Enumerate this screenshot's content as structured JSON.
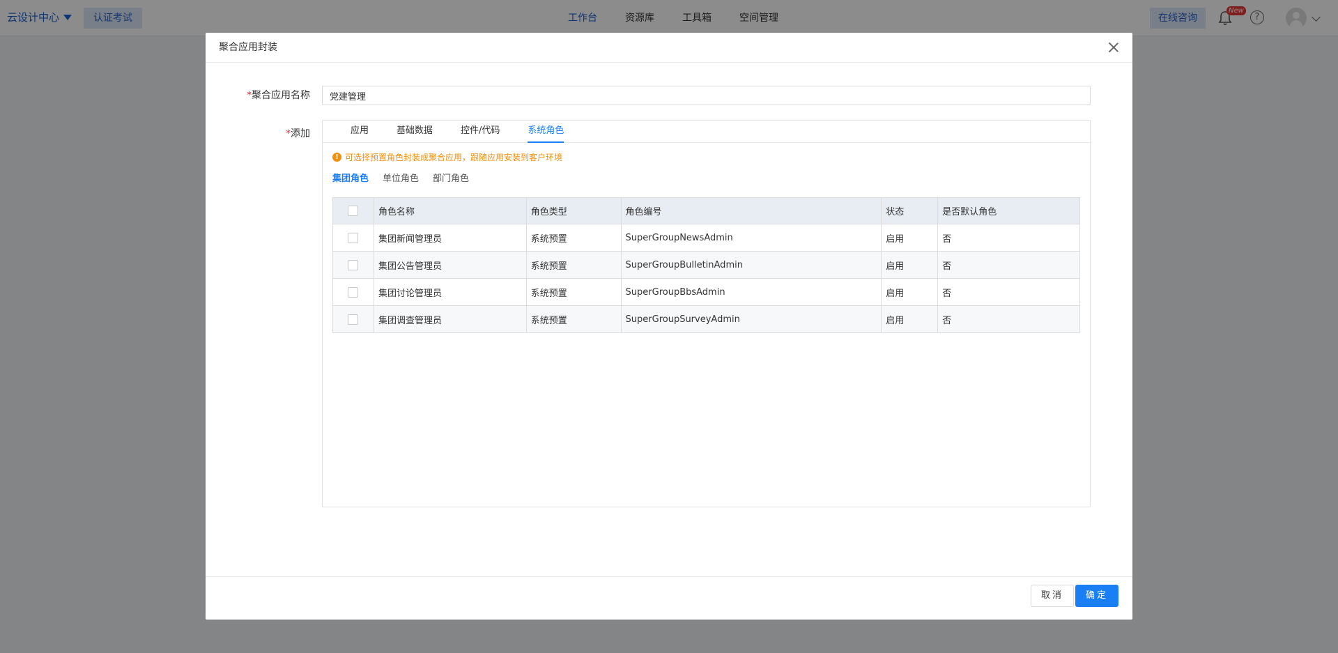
{
  "topbar": {
    "brand": "云设计中心",
    "cert_button": "认证考试",
    "nav": [
      "工作台",
      "资源库",
      "工具箱",
      "空间管理"
    ],
    "consult_button": "在线咨询",
    "new_badge": "New",
    "help_glyph": "?"
  },
  "modal": {
    "title": "聚合应用封装",
    "name_label": "聚合应用名称",
    "name_value": "党建管理",
    "add_label": "添加",
    "required_mark": "*",
    "tabs": [
      "应用",
      "基础数据",
      "控件/代码",
      "系统角色"
    ],
    "active_tab": "系统角色",
    "notice": "可选择预置角色封装成聚合应用，跟随应用安装到客户环境",
    "notice_icon_glyph": "!",
    "subtabs": [
      "集团角色",
      "单位角色",
      "部门角色"
    ],
    "active_subtab": "集团角色",
    "table": {
      "headers": [
        "角色名称",
        "角色类型",
        "角色编号",
        "状态",
        "是否默认角色"
      ],
      "rows": [
        [
          "集团新闻管理员",
          "系统预置",
          "SuperGroupNewsAdmin",
          "启用",
          "否"
        ],
        [
          "集团公告管理员",
          "系统预置",
          "SuperGroupBulletinAdmin",
          "启用",
          "否"
        ],
        [
          "集团讨论管理员",
          "系统预置",
          "SuperGroupBbsAdmin",
          "启用",
          "否"
        ],
        [
          "集团调查管理员",
          "系统预置",
          "SuperGroupSurveyAdmin",
          "启用",
          "否"
        ]
      ]
    },
    "cancel_label": "取消",
    "ok_label": "确定"
  },
  "colors": {
    "primary": "#1a7ef5",
    "warning": "#f0900c",
    "required": "#f5222d"
  }
}
